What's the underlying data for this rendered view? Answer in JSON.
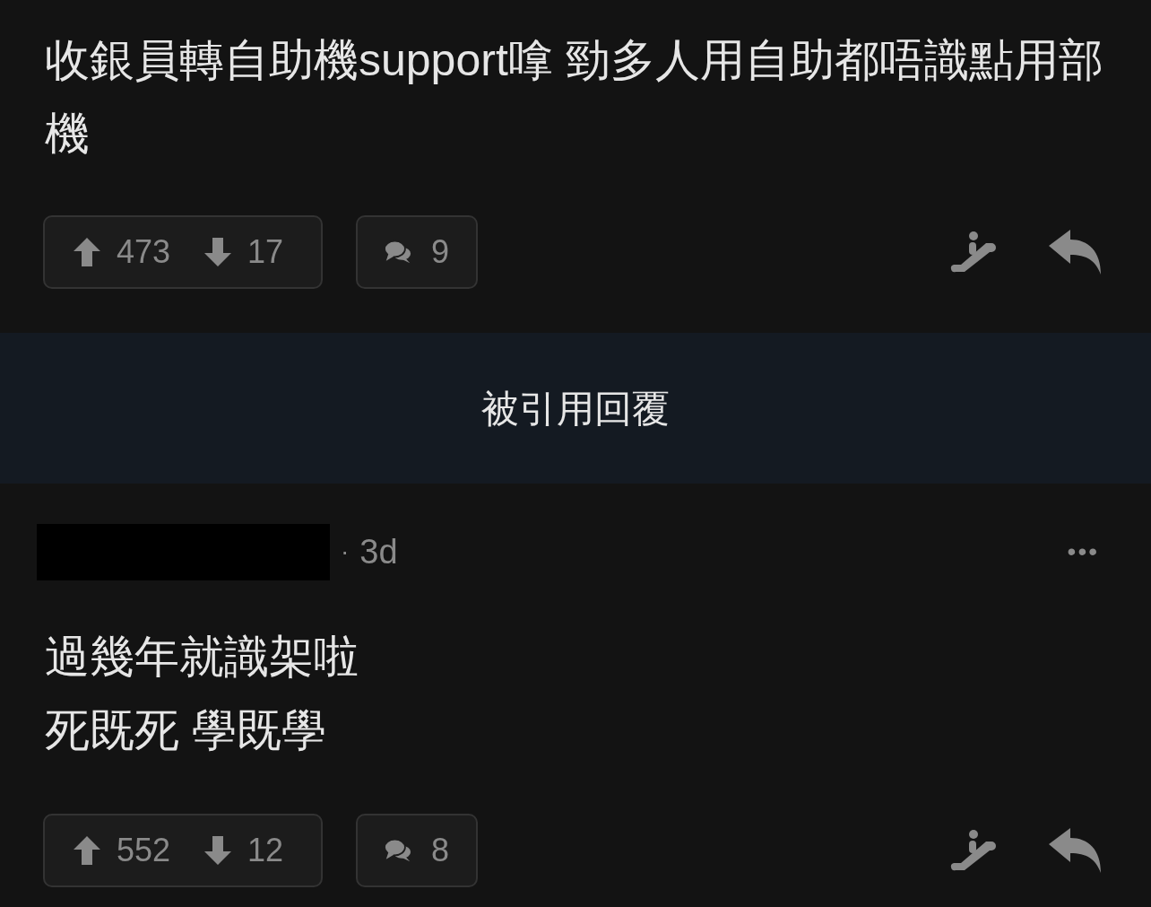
{
  "posts": [
    {
      "lines": [
        "收銀員轉自助機support嗱 勁多人用自助都唔識點用部機"
      ],
      "upvotes": "473",
      "downvotes": "17",
      "replies": "9"
    },
    {
      "header": {
        "separator": "·",
        "time": "3d",
        "menu": "•••"
      },
      "lines": [
        "過幾年就識架啦",
        "死既死 學既學"
      ],
      "upvotes": "552",
      "downvotes": "12",
      "replies": "8"
    }
  ],
  "quoted_banner": "被引用回覆"
}
